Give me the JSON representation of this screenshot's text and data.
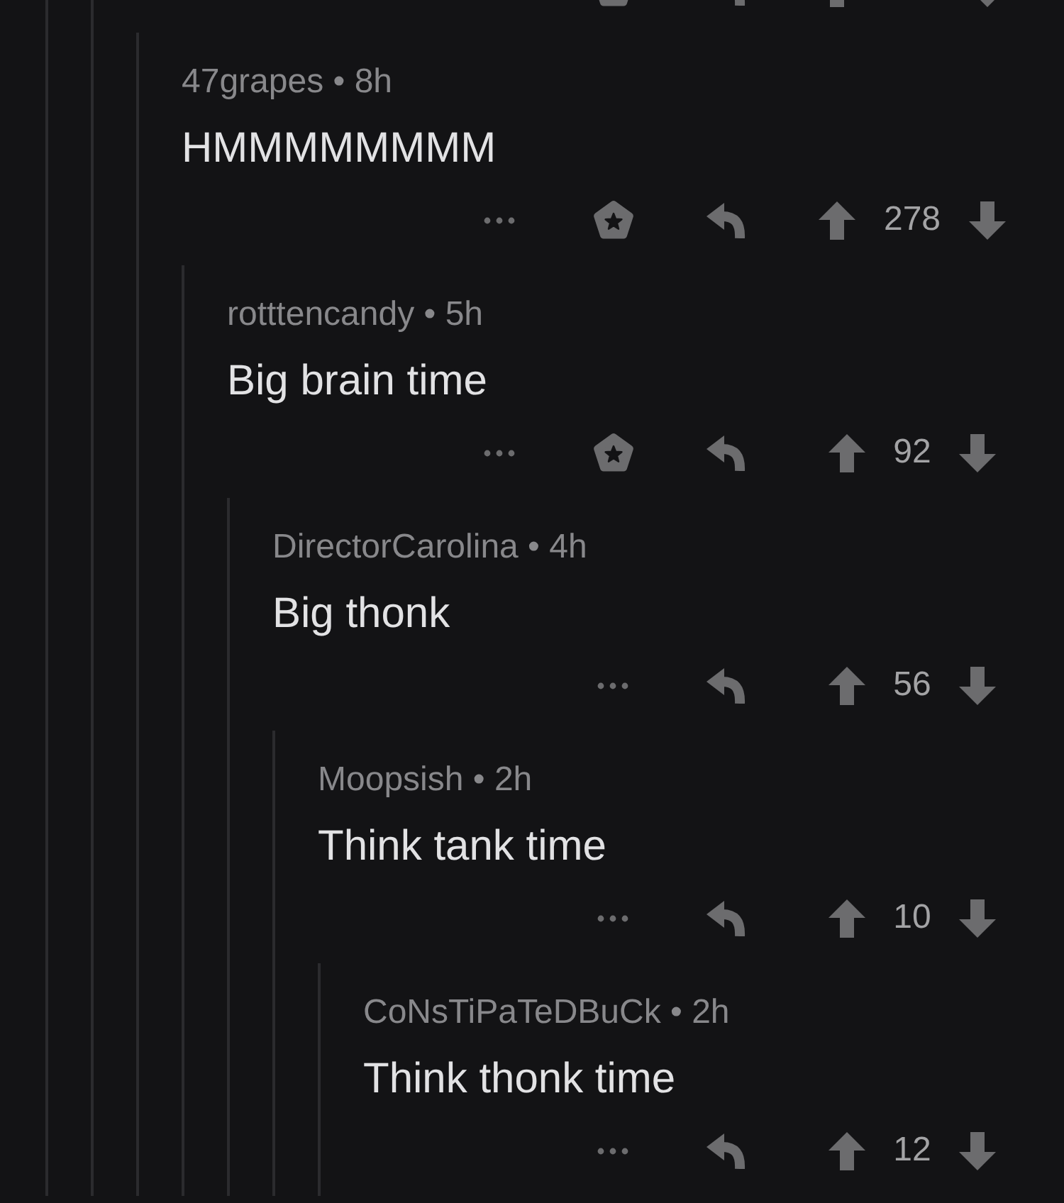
{
  "thread": {
    "kind": "line_only",
    "replies": [
      {
        "kind": "actions_only",
        "award": true,
        "replies": [
          {
            "kind": "full",
            "byline": "47grapes • 8h",
            "body": "HMMMMMMMM",
            "award": true,
            "score": "278",
            "replies": [
              {
                "kind": "full",
                "byline": "rotttencandy • 5h",
                "body": "Big brain time",
                "award": true,
                "score": "92",
                "replies": [
                  {
                    "kind": "full",
                    "byline": "DirectorCarolina • 4h",
                    "body": "Big thonk",
                    "award": false,
                    "score": "56",
                    "replies": [
                      {
                        "kind": "full",
                        "byline": "Moopsish • 2h",
                        "body": "Think tank time",
                        "award": false,
                        "score": "10",
                        "replies": [
                          {
                            "kind": "full",
                            "byline": "CoNsTiPaTeDBuCk • 2h",
                            "body": "Think thonk time",
                            "award": false,
                            "score": "12"
                          }
                        ]
                      }
                    ]
                  }
                ]
              }
            ]
          }
        ]
      }
    ]
  }
}
